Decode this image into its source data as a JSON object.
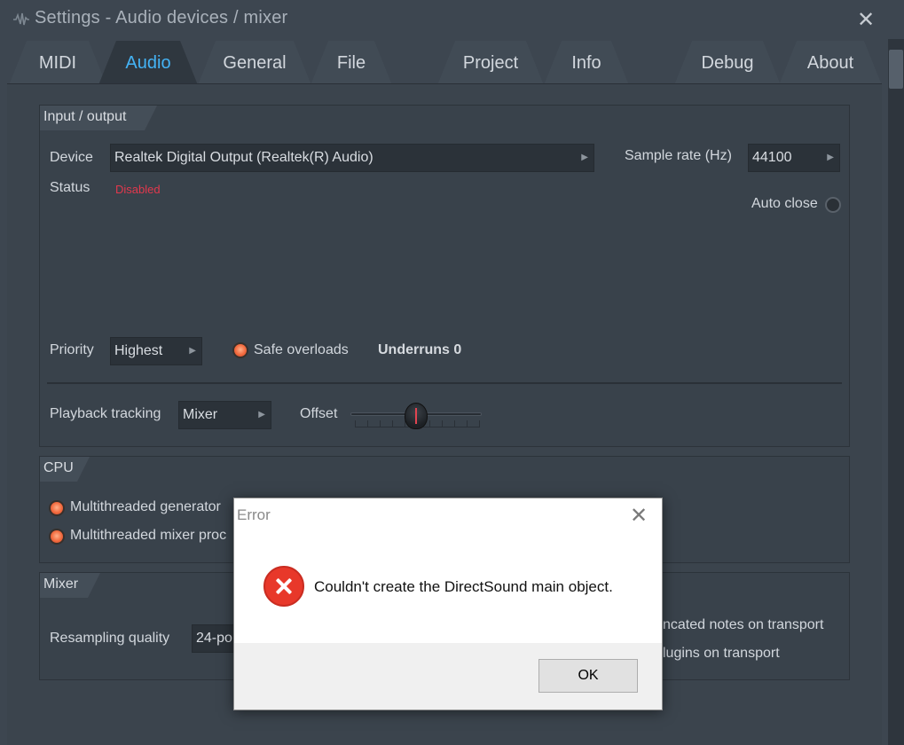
{
  "window": {
    "title": "Settings - Audio devices / mixer",
    "close_glyph": "✕"
  },
  "tabs": [
    {
      "label": "MIDI",
      "active": false
    },
    {
      "label": "Audio",
      "active": true
    },
    {
      "label": "General",
      "active": false
    },
    {
      "label": "File",
      "active": false
    },
    {
      "label": "Project",
      "active": false
    },
    {
      "label": "Info",
      "active": false
    },
    {
      "label": "Debug",
      "active": false
    },
    {
      "label": "About",
      "active": false
    }
  ],
  "io": {
    "header": "Input / output",
    "device_label": "Device",
    "device_value": "Realtek Digital Output (Realtek(R) Audio)",
    "status_label": "Status",
    "status_value": "Disabled",
    "sample_rate_label": "Sample rate (Hz)",
    "sample_rate_value": "44100",
    "auto_close_label": "Auto close",
    "priority_label": "Priority",
    "priority_value": "Highest",
    "safe_overloads_label": "Safe overloads",
    "underruns_label": "Underruns 0",
    "playback_tracking_label": "Playback tracking",
    "playback_tracking_value": "Mixer",
    "offset_label": "Offset",
    "offset_value": 0.5
  },
  "cpu": {
    "header": "CPU",
    "mt_generator_label": "Multithreaded generator",
    "mt_mixer_label": "Multithreaded mixer proc"
  },
  "mixer": {
    "header": "Mixer",
    "resampling_label": "Resampling quality",
    "resampling_value": "24-po",
    "truncated_notes_label": "ncated notes on transport",
    "plugins_label": "lugins on transport"
  },
  "dialog": {
    "title": "Error",
    "close_glyph": "✕",
    "message": "Couldn't create the DirectSound main object.",
    "ok_label": "OK"
  },
  "colors": {
    "active_tab": "#44b3f5",
    "status_disabled": "#e2384d",
    "radio_on": "#f26a3e",
    "error_icon": "#e8382a"
  }
}
